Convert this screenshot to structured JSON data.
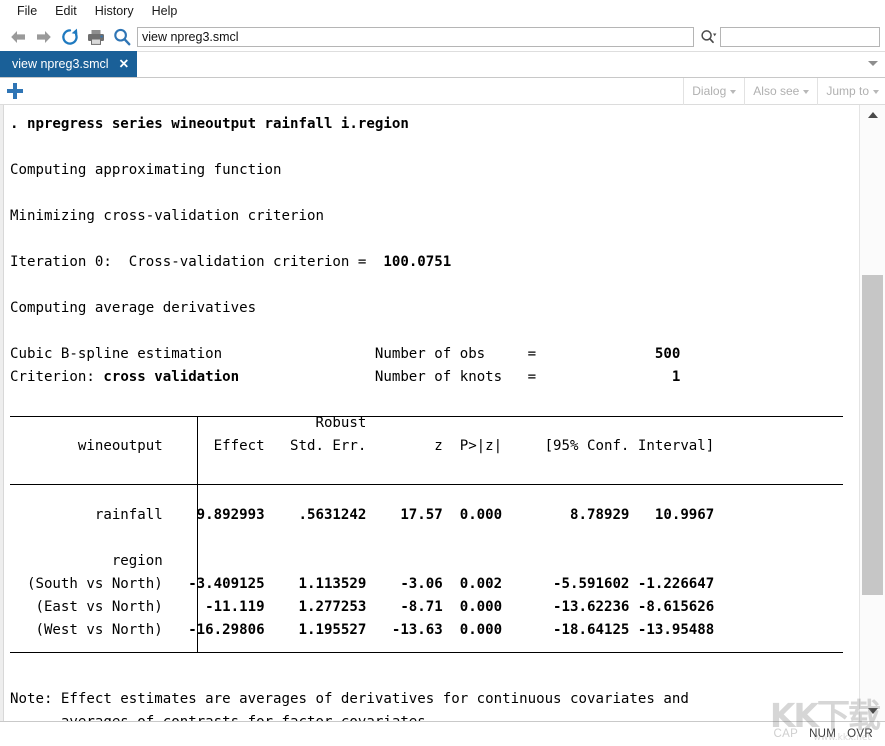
{
  "menubar": {
    "items": [
      {
        "label": "File"
      },
      {
        "label": "Edit"
      },
      {
        "label": "History"
      },
      {
        "label": "Help"
      }
    ]
  },
  "toolbar": {
    "back_icon": "arrow-left-icon",
    "forward_icon": "arrow-right-icon",
    "refresh_icon": "refresh-icon",
    "print_icon": "printer-icon",
    "find_icon": "magnifier-icon",
    "address_value": "view npreg3.smcl",
    "address_placeholder": "",
    "search_value": "",
    "search_placeholder": "",
    "search_dropdown_icon": "magnifier-dropdown-icon"
  },
  "tabs": {
    "items": [
      {
        "label": "view npreg3.smcl",
        "close_label": "✕",
        "active": true
      }
    ],
    "overflow_icon": "chevron-down-icon"
  },
  "subbar": {
    "new_tab_icon": "plus-icon",
    "menus": [
      {
        "label": "Dialog"
      },
      {
        "label": "Also see"
      },
      {
        "label": "Jump to"
      }
    ]
  },
  "output": {
    "command_prompt": ".",
    "command": "npregress series wineoutput rainfall i.region",
    "messages": [
      "Computing approximating function",
      "Minimizing cross-validation criterion"
    ],
    "iteration_label": "Iteration 0:  Cross-validation criterion =",
    "iteration_value": "100.0751",
    "message_after": "Computing average derivatives",
    "model_lines": [
      {
        "left": "Cubic B-spline estimation",
        "right_label": "Number of obs",
        "eq": "=",
        "right_value": "500"
      },
      {
        "left_plain": "Criterion: ",
        "left_bold": "cross validation",
        "right_label": "Number of knots",
        "eq": "=",
        "right_value": "1"
      }
    ],
    "table": {
      "depvar": "wineoutput",
      "super_header": "Robust",
      "headers": [
        "Effect",
        "Std. Err.",
        "z",
        "P>|z|",
        "[95% Conf. Interval]"
      ],
      "rows": [
        {
          "label": "rainfall",
          "type": "data",
          "effect": "9.892993",
          "std_err": ".5631242",
          "z": "17.57",
          "p": "0.000",
          "ci_low": "8.78929",
          "ci_high": "10.9967"
        },
        {
          "label": "region",
          "type": "group"
        },
        {
          "label": "(South vs North)",
          "type": "data",
          "effect": "-3.409125",
          "std_err": "1.113529",
          "z": "-3.06",
          "p": "0.002",
          "ci_low": "-5.591602",
          "ci_high": "-1.226647"
        },
        {
          "label": "(East vs North)",
          "type": "data",
          "effect": "-11.119",
          "std_err": "1.277253",
          "z": "-8.71",
          "p": "0.000",
          "ci_low": "-13.62236",
          "ci_high": "-8.615626"
        },
        {
          "label": "(West vs North)",
          "type": "data",
          "effect": "-16.29806",
          "std_err": "1.195527",
          "z": "-13.63",
          "p": "0.000",
          "ci_low": "-18.64125",
          "ci_high": "-13.95488"
        }
      ]
    },
    "note_lines": [
      "Note: Effect estimates are averages of derivatives for continuous covariates and",
      "      averages of contrasts for factor covariates."
    ]
  },
  "scrollbar": {
    "up_icon": "chevron-up-icon",
    "down_icon": "chevron-down-icon"
  },
  "statusbar": {
    "items": [
      {
        "label": "CAP",
        "state": "off"
      },
      {
        "label": "NUM",
        "state": "on"
      },
      {
        "label": "OVR",
        "state": "on"
      }
    ]
  },
  "watermark": {
    "text": "KK下载",
    "subtext": "www.kkx.net"
  },
  "colors": {
    "tab_active_bg": "#1a6098",
    "accent_blue": "#2f75b5",
    "text": "#000000",
    "muted": "#b0b0b0"
  }
}
